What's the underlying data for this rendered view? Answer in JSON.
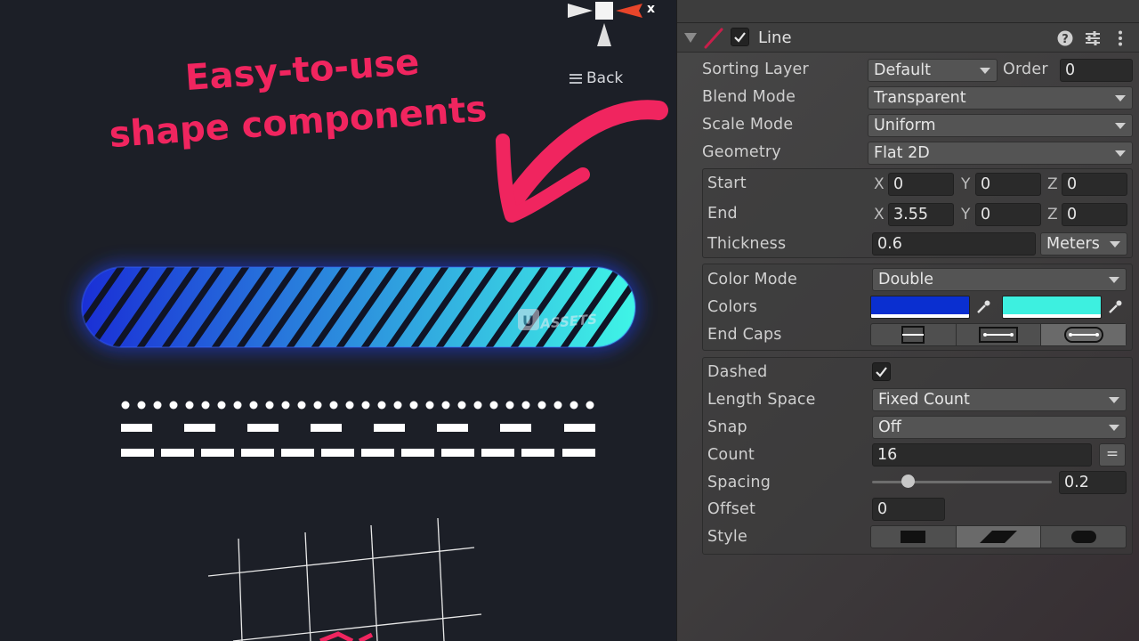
{
  "scene": {
    "headline_line1": "Easy-to-use",
    "headline_line2": "shape components",
    "back_label": "Back",
    "gizmo_axis_label": "x",
    "watermark": "ASSETS",
    "gradient_start": "#1a2fd6",
    "gradient_end": "#3ff5e6",
    "accent": "#f0255f"
  },
  "component": {
    "title": "Line",
    "enabled": true,
    "icons": [
      "help-icon",
      "preset-icon",
      "more-vertical-icon"
    ]
  },
  "fields": {
    "sorting_layer": {
      "label": "Sorting Layer",
      "value": "Default"
    },
    "order": {
      "label": "Order",
      "value": "0"
    },
    "blend_mode": {
      "label": "Blend Mode",
      "value": "Transparent"
    },
    "scale_mode": {
      "label": "Scale Mode",
      "value": "Uniform"
    },
    "geometry": {
      "label": "Geometry",
      "value": "Flat 2D"
    },
    "start": {
      "label": "Start",
      "x": "0",
      "y": "0",
      "z": "0"
    },
    "end": {
      "label": "End",
      "x": "3.55",
      "y": "0",
      "z": "0"
    },
    "thickness": {
      "label": "Thickness",
      "value": "0.6",
      "unit": "Meters"
    },
    "color_mode": {
      "label": "Color Mode",
      "value": "Double"
    },
    "colors": {
      "label": "Colors",
      "start_color": "#0a2fd0",
      "end_color": "#3df0e0"
    },
    "end_caps": {
      "label": "End Caps",
      "selected_index": 2
    },
    "dashed": {
      "label": "Dashed",
      "checked": true
    },
    "length_space": {
      "label": "Length Space",
      "value": "Fixed Count"
    },
    "snap": {
      "label": "Snap",
      "value": "Off"
    },
    "count": {
      "label": "Count",
      "value": "16",
      "equals": "="
    },
    "spacing": {
      "label": "Spacing",
      "value": "0.2",
      "slider_fraction": 0.2
    },
    "offset": {
      "label": "Offset",
      "value": "0"
    },
    "style": {
      "label": "Style",
      "selected_index": 1
    }
  },
  "axis_labels": {
    "x": "X",
    "y": "Y",
    "z": "Z"
  }
}
